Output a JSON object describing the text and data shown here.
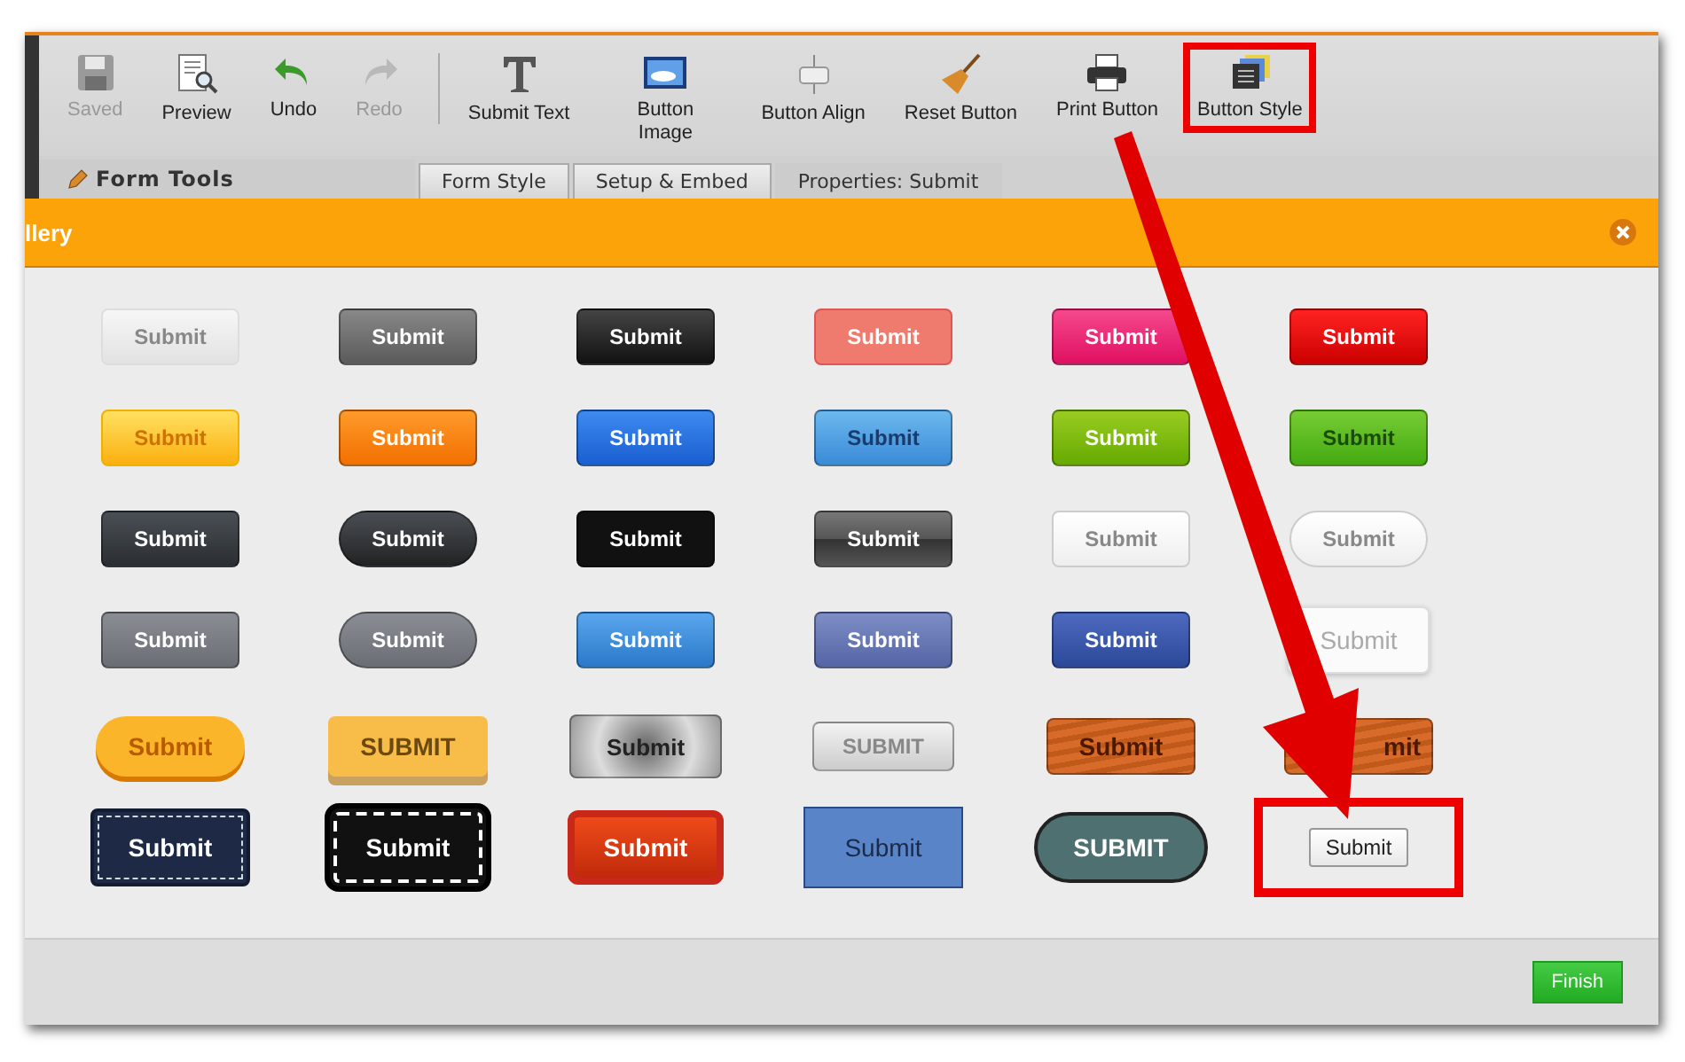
{
  "toolbar": [
    {
      "label": "Saved",
      "disabled": true,
      "highlighted": false
    },
    {
      "label": "Preview",
      "disabled": false,
      "highlighted": false
    },
    {
      "label": "Undo",
      "disabled": false,
      "highlighted": false
    },
    {
      "label": "Redo",
      "disabled": true,
      "highlighted": false
    },
    {
      "label": "Submit Text",
      "disabled": false,
      "highlighted": false
    },
    {
      "label": "Button Image",
      "disabled": false,
      "highlighted": false
    },
    {
      "label": "Button Align",
      "disabled": false,
      "highlighted": false
    },
    {
      "label": "Reset Button",
      "disabled": false,
      "highlighted": false
    },
    {
      "label": "Print Button",
      "disabled": false,
      "highlighted": false
    },
    {
      "label": "Button Style",
      "disabled": false,
      "highlighted": true
    }
  ],
  "sidebar": {
    "title": "Form Tools"
  },
  "tabs": [
    {
      "label": "Form Style",
      "selected": false
    },
    {
      "label": "Setup & Embed",
      "selected": false
    },
    {
      "label": "Properties: Submit",
      "selected": true
    }
  ],
  "dialog": {
    "title": "llery",
    "buttons": [
      {
        "label": "Submit",
        "kind": "light",
        "highlighted": false
      },
      {
        "label": "Submit",
        "kind": "dark",
        "highlighted": false
      },
      {
        "label": "Submit",
        "kind": "black",
        "highlighted": false
      },
      {
        "label": "Submit",
        "kind": "salmon",
        "highlighted": false
      },
      {
        "label": "Submit",
        "kind": "pink",
        "highlighted": false
      },
      {
        "label": "Submit",
        "kind": "red",
        "highlighted": false
      },
      {
        "label": "Submit",
        "kind": "yellow",
        "highlighted": false
      },
      {
        "label": "Submit",
        "kind": "orange",
        "highlighted": false
      },
      {
        "label": "Submit",
        "kind": "blue",
        "highlighted": false
      },
      {
        "label": "Submit",
        "kind": "sky",
        "highlighted": false
      },
      {
        "label": "Submit",
        "kind": "lime",
        "highlighted": false
      },
      {
        "label": "Submit",
        "kind": "green",
        "highlighted": false
      },
      {
        "label": "Submit",
        "kind": "charcoal",
        "highlighted": false
      },
      {
        "label": "Submit",
        "kind": "charcoalpill",
        "highlighted": false
      },
      {
        "label": "Submit",
        "kind": "ink",
        "highlighted": false
      },
      {
        "label": "Submit",
        "kind": "steel",
        "highlighted": false
      },
      {
        "label": "Submit",
        "kind": "white",
        "highlighted": false
      },
      {
        "label": "Submit",
        "kind": "whitepill",
        "highlighted": false
      },
      {
        "label": "Submit",
        "kind": "gray",
        "highlighted": false
      },
      {
        "label": "Submit",
        "kind": "graypill",
        "highlighted": false
      },
      {
        "label": "Submit",
        "kind": "azure",
        "highlighted": false
      },
      {
        "label": "Submit",
        "kind": "slate",
        "highlighted": false
      },
      {
        "label": "Submit",
        "kind": "navy",
        "highlighted": false
      },
      {
        "label": "Submit",
        "kind": "ghost",
        "highlighted": false
      },
      {
        "label": "Submit",
        "kind": "goldpill",
        "highlighted": false
      },
      {
        "label": "SUBMIT",
        "kind": "goldblock",
        "highlighted": false
      },
      {
        "label": "Submit",
        "kind": "brushed",
        "highlighted": false
      },
      {
        "label": "SUBMIT",
        "kind": "silver",
        "highlighted": false
      },
      {
        "label": "Submit",
        "kind": "wood",
        "highlighted": false
      },
      {
        "label": "mit",
        "kind": "wood",
        "highlighted": false
      },
      {
        "label": "Submit",
        "kind": "denim",
        "highlighted": false
      },
      {
        "label": "Submit",
        "kind": "leather",
        "highlighted": false
      },
      {
        "label": "Submit",
        "kind": "crimson",
        "highlighted": false
      },
      {
        "label": "Submit",
        "kind": "flatblue",
        "highlighted": false
      },
      {
        "label": "SUBMIT",
        "kind": "tealpill",
        "highlighted": false
      },
      {
        "label": "Submit",
        "kind": "plain",
        "highlighted": true
      }
    ],
    "footer_button": "Finish"
  }
}
